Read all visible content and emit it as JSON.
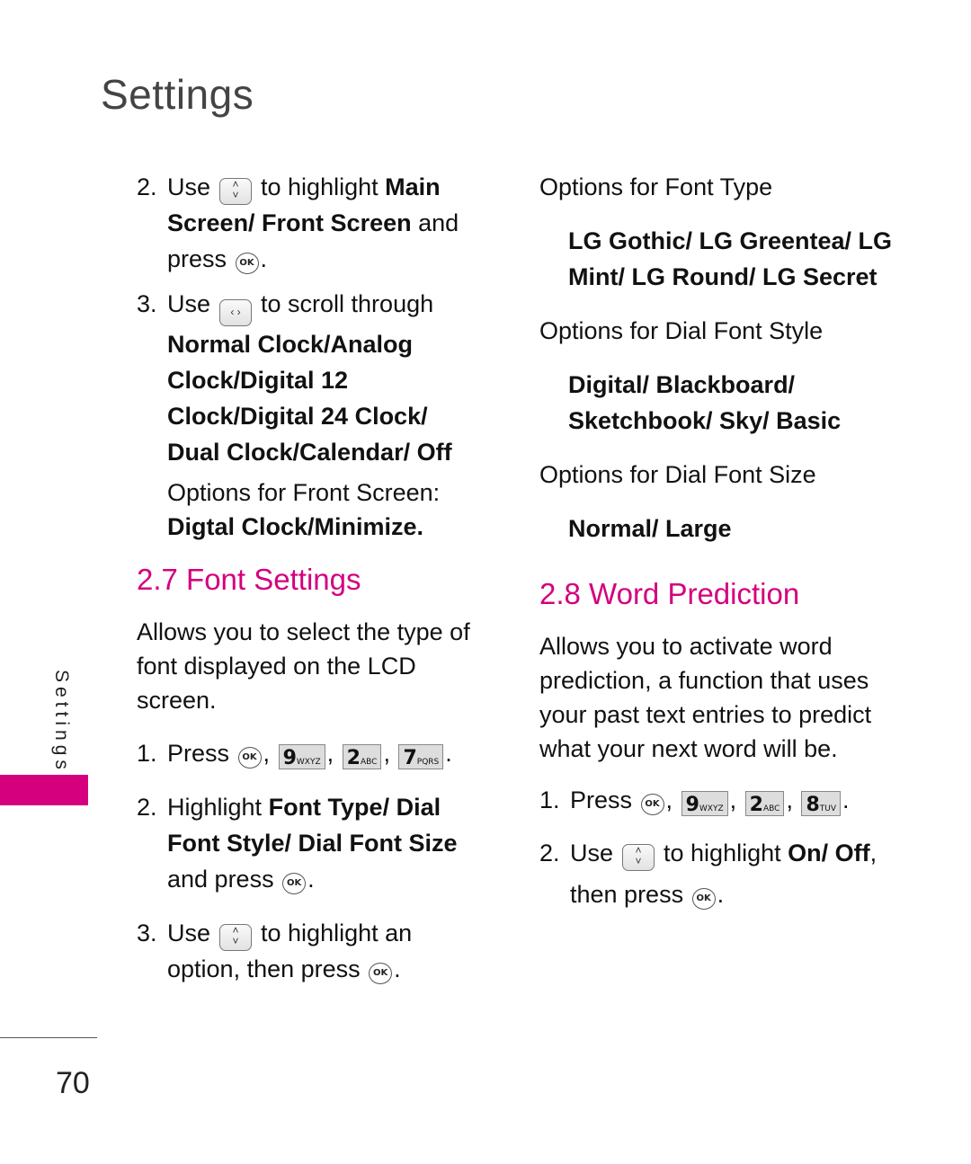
{
  "header": {
    "title": "Settings"
  },
  "sidebar": {
    "label": "Settings",
    "accent_color": "#d4007e"
  },
  "footer": {
    "page_number": "70"
  },
  "icons": {
    "ok": "OK",
    "nav_updown_up": "˄",
    "nav_updown_down": "˅",
    "nav_leftright": "‹ ›",
    "key9": {
      "digit": "9",
      "letters": "WXYZ"
    },
    "key2": {
      "digit": "2",
      "letters": "ABC"
    },
    "key7": {
      "digit": "7",
      "letters": "PQRS"
    },
    "key8": {
      "digit": "8",
      "letters": "TUV"
    }
  },
  "left": {
    "step2": {
      "num": "2.",
      "use": "Use",
      "to_highlight": "to highlight",
      "bold1": "Main",
      "bold2": "Screen/ Front Screen",
      "and": " and",
      "press": "press",
      "period": "."
    },
    "step3": {
      "num": "3.",
      "use": "Use",
      "to_scroll": "to scroll through",
      "bold_lines": [
        "Normal Clock/Analog",
        "Clock/Digital 12",
        "Clock/Digital 24 Clock/",
        "Dual Clock/Calendar/ Off"
      ],
      "front_label": "Options for Front Screen:",
      "front_options": "Digtal Clock/Minimize."
    },
    "font_settings": {
      "heading": "2.7 Font Settings",
      "desc": [
        "Allows you to select the type of",
        "font displayed on the LCD",
        "screen."
      ],
      "step1": {
        "num": "1.",
        "press": "Press",
        "sep": ",",
        "end": "."
      },
      "step2": {
        "num": "2.",
        "highlight": "Highlight",
        "bold1": "Font Type/ Dial",
        "bold2": "Font Style/ Dial Font Size",
        "and_press": "and press",
        "period": "."
      },
      "step3": {
        "num": "3.",
        "use": "Use",
        "to_highlight": "to highlight an",
        "option_then": "option, then press",
        "period": "."
      }
    }
  },
  "right": {
    "font_type_label": "Options for Font Type",
    "font_type_options": [
      "LG Gothic/ LG Greentea/ LG",
      "Mint/ LG Round/ LG Secret"
    ],
    "dial_style_label": "Options for Dial Font Style",
    "dial_style_options": [
      "Digital/ Blackboard/",
      "Sketchbook/ Sky/ Basic"
    ],
    "dial_size_label": "Options for Dial Font Size",
    "dial_size_options": "Normal/ Large",
    "word_prediction": {
      "heading": "2.8 Word Prediction",
      "desc": [
        "Allows you to activate word",
        "prediction, a function that uses",
        "your past text entries to predict",
        "what your next word will be."
      ],
      "step1": {
        "num": "1.",
        "press": "Press",
        "sep": ",",
        "end": "."
      },
      "step2": {
        "num": "2.",
        "use": "Use",
        "to_highlight": "to highlight",
        "bold": "On/ Off",
        "comma": ",",
        "then_press": "then press",
        "period": "."
      }
    }
  }
}
